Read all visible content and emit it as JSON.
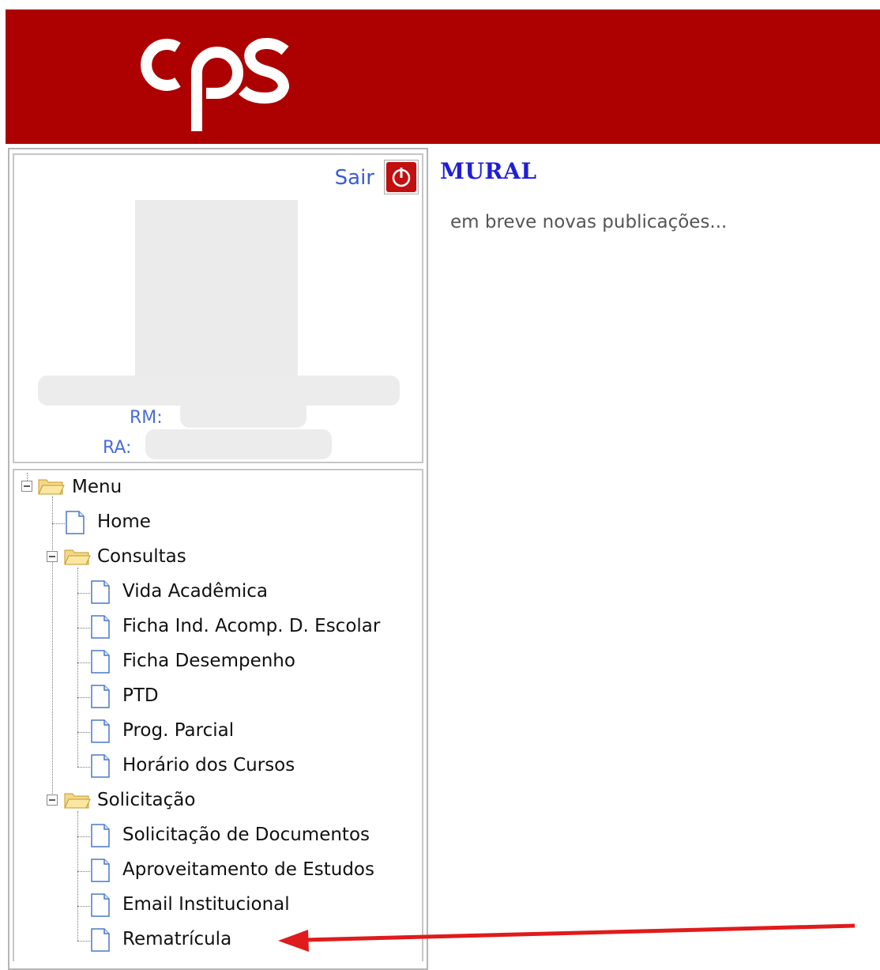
{
  "header": {
    "logo_text": "cps",
    "brand_color": "#ad0000"
  },
  "profile": {
    "logout_label": "Sair",
    "logout_icon": "power-icon",
    "rm_label": "RM:",
    "ra_label": "RA:"
  },
  "menu": {
    "root": "Menu",
    "items": [
      {
        "label": "Home"
      },
      {
        "label": "Consultas",
        "children": [
          "Vida Acadêmica",
          "Ficha Ind. Acomp. D. Escolar",
          "Ficha Desempenho",
          "PTD",
          "Prog. Parcial",
          "Horário dos Cursos"
        ]
      },
      {
        "label": "Solicitação",
        "children": [
          "Solicitação de Documentos",
          "Aproveitamento de Estudos",
          "Email Institucional",
          "Rematrícula"
        ]
      }
    ]
  },
  "main": {
    "title": "MURAL",
    "notice": "em breve novas publicações..."
  },
  "annotation": {
    "arrow_color": "#e01b1b"
  }
}
